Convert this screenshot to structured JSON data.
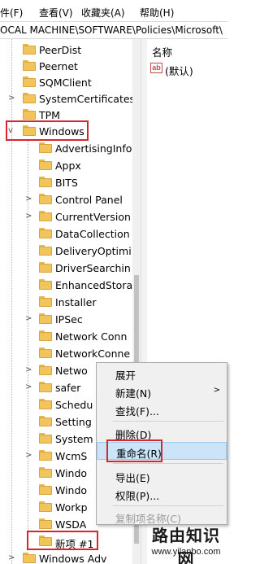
{
  "menubar": {
    "items": [
      "件(F)",
      "查看(V)",
      "收藏夹(A)",
      "帮助(H)"
    ]
  },
  "address": {
    "path": "OCAL MACHINE\\SOFTWARE\\Policies\\Microsoft\\"
  },
  "tree": {
    "top_items": [
      {
        "label": "PeerDist",
        "expander": ""
      },
      {
        "label": "Peernet",
        "expander": ""
      },
      {
        "label": "SQMClient",
        "expander": ""
      },
      {
        "label": "SystemCertificates",
        "expander": ">"
      },
      {
        "label": "TPM",
        "expander": ""
      },
      {
        "label": "Windows",
        "expander": "v"
      }
    ],
    "children": [
      {
        "label": "AdvertisingInfo",
        "expander": ""
      },
      {
        "label": "Appx",
        "expander": ""
      },
      {
        "label": "BITS",
        "expander": ""
      },
      {
        "label": "Control Panel",
        "expander": ">"
      },
      {
        "label": "CurrentVersion",
        "expander": ">"
      },
      {
        "label": "DataCollection",
        "expander": ""
      },
      {
        "label": "DeliveryOptimi",
        "expander": ""
      },
      {
        "label": "DriverSearchin",
        "expander": ""
      },
      {
        "label": "EnhancedStora",
        "expander": ""
      },
      {
        "label": "Installer",
        "expander": ""
      },
      {
        "label": "IPSec",
        "expander": ">"
      },
      {
        "label": "Network Conn",
        "expander": ""
      },
      {
        "label": "NetworkConne",
        "expander": ""
      },
      {
        "label": "Netwo",
        "expander": ">"
      },
      {
        "label": "safer",
        "expander": ">"
      },
      {
        "label": "Schedu",
        "expander": ""
      },
      {
        "label": "Setting",
        "expander": ""
      },
      {
        "label": "System",
        "expander": ""
      },
      {
        "label": "WcmS",
        "expander": ">"
      },
      {
        "label": "Windo",
        "expander": ""
      },
      {
        "label": "Windo",
        "expander": ""
      },
      {
        "label": "Workp",
        "expander": ""
      },
      {
        "label": "WSDA",
        "expander": ""
      },
      {
        "label": "新项 #1",
        "expander": ""
      }
    ],
    "bottom_item": {
      "label": "Windows Adv",
      "expander": ">"
    }
  },
  "values": {
    "column_header": "名称",
    "rows": [
      {
        "icon": "ab",
        "name": "(默认)"
      }
    ]
  },
  "context_menu": {
    "items": [
      {
        "label": "展开",
        "submenu": false
      },
      {
        "label": "新建(N)",
        "submenu": true,
        "arrow": ">"
      },
      {
        "label": "查找(F)...",
        "submenu": false
      },
      {
        "label": "删除(D)",
        "submenu": false
      },
      {
        "label": "重命名(R)",
        "submenu": false
      },
      {
        "label": "导出(E)",
        "submenu": false
      },
      {
        "label": "权限(P)...",
        "submenu": false
      },
      {
        "label": "复制项名称(C)",
        "submenu": false
      }
    ]
  },
  "watermark": {
    "title": "路由知识网",
    "url": "www.yilanbo.com"
  },
  "colors": {
    "highlight_red": "#d9262d",
    "menu_hover": "#cce4f7",
    "folder_yellow": "#f2c55c"
  }
}
